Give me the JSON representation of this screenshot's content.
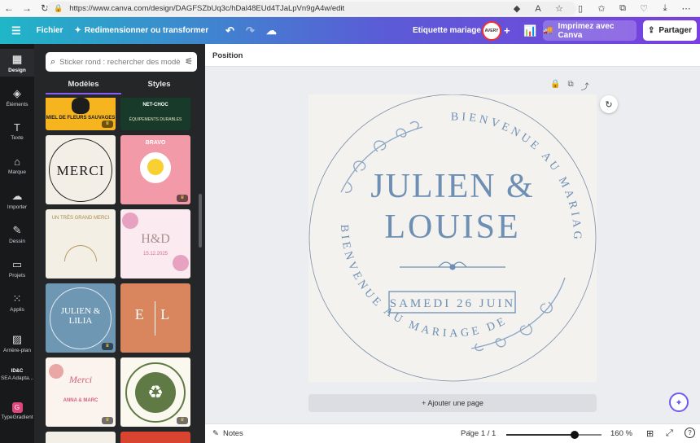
{
  "browser": {
    "url": "https://www.canva.com/design/DAGFSZbUq3c/hDal48EUd4TJaLpVn9gA4w/edit",
    "nav_icons": [
      "back-icon",
      "forward-icon",
      "reload-icon"
    ]
  },
  "topbar": {
    "menu_label": "Fichier",
    "resize_label": "Redimensionner ou transformer",
    "design_title": "Etiquette mariage",
    "avatar_text": "AVERY",
    "print_label": "Imprimez avec Canva",
    "share_label": "Partager"
  },
  "rail": {
    "items": [
      {
        "label": "Design",
        "icon": "design-icon"
      },
      {
        "label": "Éléments",
        "icon": "elements-icon"
      },
      {
        "label": "Texte",
        "icon": "text-icon"
      },
      {
        "label": "Marque",
        "icon": "brand-icon"
      },
      {
        "label": "Importer",
        "icon": "upload-icon"
      },
      {
        "label": "Dessin",
        "icon": "draw-icon"
      },
      {
        "label": "Projets",
        "icon": "projects-icon"
      },
      {
        "label": "Applis",
        "icon": "apps-icon"
      },
      {
        "label": "Arrière-plan",
        "icon": "background-icon"
      },
      {
        "label": "SEA Adapta...",
        "icon": "app-sea-icon"
      },
      {
        "label": "TypeGradient",
        "icon": "app-typegradient-icon"
      }
    ],
    "sea_badge": "ID&C"
  },
  "panel": {
    "search_placeholder": "Sticker rond : rechercher des modè",
    "tabs": [
      "Modèles",
      "Styles"
    ],
    "thumbs": [
      {
        "title": "MIEL DE FLEURS SAUVAGES"
      },
      {
        "title": "NET-CHOC",
        "sub": "ÉQUIPEMENTS DURABLES"
      },
      {
        "title": "MERCI"
      },
      {
        "title": "BRAVO"
      },
      {
        "title": "UN TRÈS GRAND MERCI"
      },
      {
        "title": "H&D",
        "sub": "15.12.2025"
      },
      {
        "title": "JULIEN & LILIA"
      },
      {
        "title": "E L"
      },
      {
        "title": "Merci",
        "sub": "ANNA & MARC"
      },
      {
        "title": "recycle"
      }
    ]
  },
  "editor": {
    "position_label": "Position",
    "add_page_label": "+ Ajouter une page",
    "design": {
      "arc_top": "BIENVENUE AU MARIAGE DE",
      "arc_bottom": "BIENVENUE AU MARIAGE DE",
      "names_line1": "JULIEN &",
      "names_line2": "LOUISE",
      "date": "SAMEDI 26 JUIN",
      "text_color": "#6e8fb4"
    }
  },
  "bottombar": {
    "notes_label": "Notes",
    "page_label": "Page 1 / 1",
    "zoom_label": "160 %",
    "zoom_percent": 160,
    "zoom_fraction": 0.72
  }
}
